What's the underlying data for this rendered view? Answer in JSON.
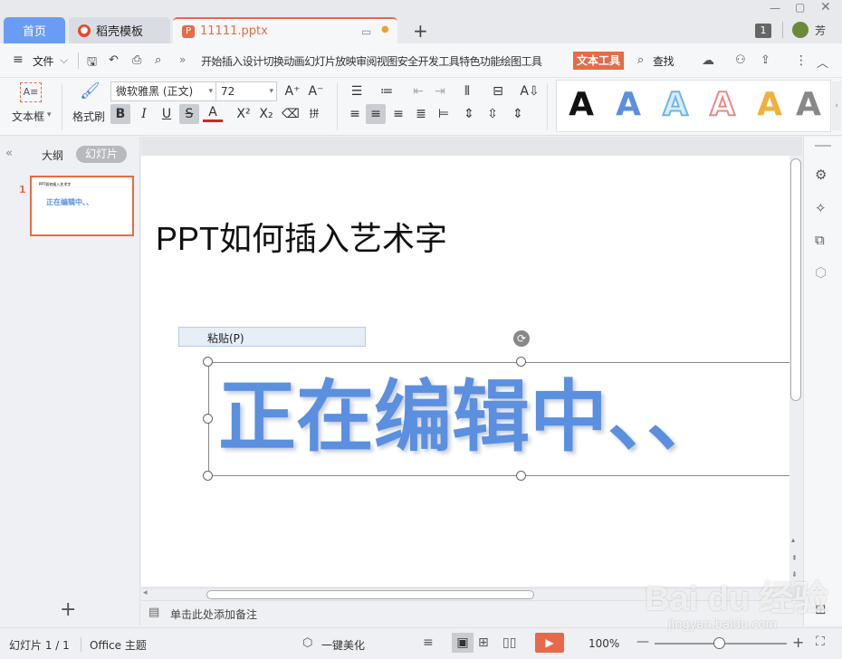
{
  "tabs": {
    "home": "首页",
    "daoke": "稻壳模板",
    "file": "11111.pptx",
    "new_tab": "+"
  },
  "window": {
    "badge": "1",
    "user": "芳"
  },
  "menu": {
    "file": "文件",
    "items": [
      "开始",
      "插入",
      "设计",
      "切换",
      "动画",
      "幻灯片放映",
      "审阅",
      "视图",
      "安全",
      "开发工具",
      "特色功能",
      "绘图工具"
    ],
    "active": "文本工具",
    "search": "查找",
    "more": "»"
  },
  "ribbon": {
    "textbox_label": "文本框",
    "format_painter_label": "格式刷",
    "font_name": "微软雅黑 (正文)",
    "font_size": "72",
    "wordart_sample": "A"
  },
  "leftpanel": {
    "outline_tab": "大纲",
    "slides_tab": "幻灯片",
    "slide_number": "1",
    "thumb_title": "PPT如何插入艺术字",
    "thumb_text": "正在编辑中、、",
    "add": "+"
  },
  "slide": {
    "title": "PPT如何插入艺术字",
    "paste_option": "粘贴(P)",
    "wordart_text": "正在编辑中、、"
  },
  "notes": {
    "placeholder": "单击此处添加备注"
  },
  "status": {
    "slide_info": "幻灯片 1 / 1",
    "theme": "Office 主题",
    "beautify": "一键美化",
    "zoom": "100%"
  },
  "colors": {
    "accent": "#e46c47",
    "wordart_blue": "#5b8fdf",
    "tab_blue": "#6b9cf5"
  },
  "watermark": {
    "text": "Bai du 经验",
    "url": "jingyan.baidu.com"
  }
}
